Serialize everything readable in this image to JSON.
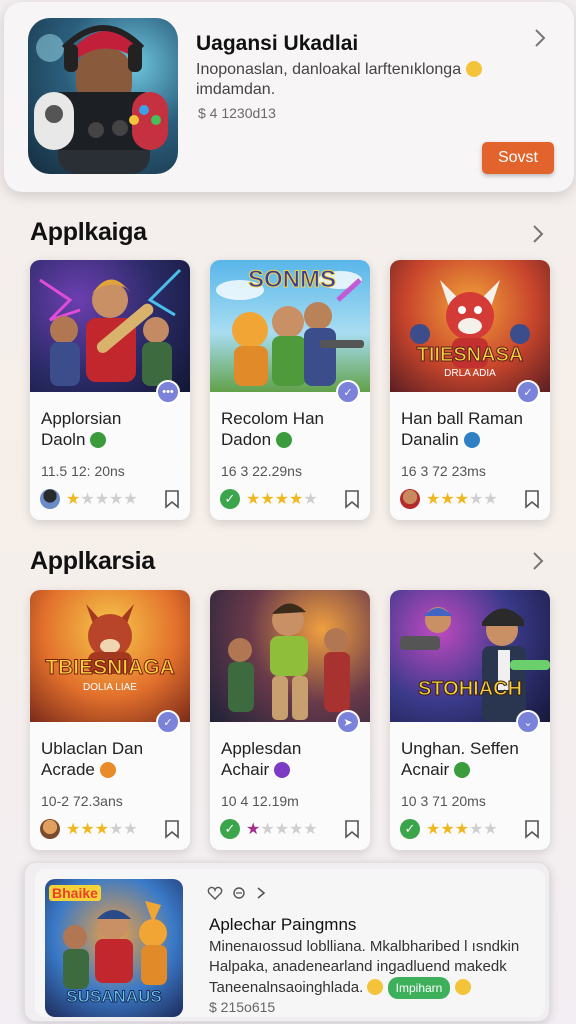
{
  "featured": {
    "title": "Uagansi Ukadlai",
    "description": "Inoponaslan, danloakal larftenıklonga",
    "description2": "imdamdan.",
    "meta": "$ 4 1230d13",
    "cta_label": "Sovst"
  },
  "sections": [
    {
      "title": "Applkaiga",
      "cards": [
        {
          "name": "Applorsian",
          "sub": "Daoln",
          "stat": "11.5 12: 20ns",
          "rating": 1,
          "emoji_color": "#3b9c3e"
        },
        {
          "name": "Recolom Han",
          "sub": "Dadon",
          "stat": "16 3 22.29ns",
          "rating": 4,
          "emoji_color": "#3b9c3e"
        },
        {
          "name": "Han ball Raman",
          "sub": "Danalin",
          "stat": "16 3 72 23ms",
          "rating": 3,
          "emoji_color": "#2f7fc4"
        }
      ]
    },
    {
      "title": "Applkarsia",
      "cards": [
        {
          "name": "Ublaclan Dan",
          "sub": "Acrade",
          "stat": "10-2 72.3ans",
          "rating": 3,
          "emoji_color": "#e98b28"
        },
        {
          "name": "Applesdan",
          "sub": "Achair",
          "stat": "10 4 12.19m",
          "rating": 1,
          "emoji_color": "#7b3bc4"
        },
        {
          "name": "Unghan. Seffen",
          "sub": "Acnair",
          "stat": "10 3 71 20ms",
          "rating": 3,
          "emoji_color": "#3b9c3e"
        }
      ]
    }
  ],
  "promo": {
    "art_label_top": "Bhaike",
    "art_label_bottom": "SUSANAUS",
    "title": "Aplechar Paingmns",
    "desc1": "Minenaıossud loblliana. Mkalbharibed l ısndkin",
    "desc2": "Halpaka, anadenearland ingadluend makedk",
    "desc3": "Taneenalnsaoinghlada.",
    "tag": "Impiharn",
    "meta": "$ 215o615"
  },
  "thumb_labels": {
    "s1c2": "SONMS",
    "s1c3": "TIIESNASA",
    "s1c3b": "DRLA ADIA",
    "s2c1": "TBIESNIAGA",
    "s2c1b": "DOLIA LIAE",
    "s2c3": "STOHIACH"
  },
  "colors": {
    "accent": "#e2632b",
    "star": "#f0b820",
    "check": "#3aa54a",
    "badge": "#7b82d9"
  }
}
